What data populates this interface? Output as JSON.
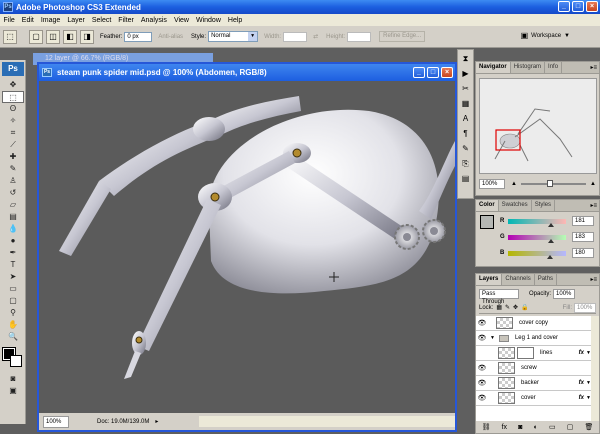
{
  "window": {
    "title": "Adobe Photoshop CS3 Extended",
    "app_icon": "Ps"
  },
  "menu": [
    "File",
    "Edit",
    "Image",
    "Layer",
    "Select",
    "Filter",
    "Analysis",
    "View",
    "Window",
    "Help"
  ],
  "options": {
    "feather_label": "Feather:",
    "feather_value": "0 px",
    "antialias_label": "Anti-alias",
    "style_label": "Style:",
    "style_value": "Normal",
    "width_label": "Width:",
    "height_label": "Height:",
    "refine_label": "Refine Edge...",
    "workspace_label": "Workspace"
  },
  "toolbox": {
    "logo": "Ps"
  },
  "document": {
    "back_title": "12 layer @ 66.7% (RGB/8)",
    "title": "steam punk spider mid.psd @ 100% (Abdomen, RGB/8)",
    "zoom": "100%",
    "doc_info": "Doc: 19.0M/139.0M"
  },
  "navigator": {
    "tabs": [
      "Navigator",
      "Histogram",
      "Info"
    ],
    "zoom": "100%"
  },
  "color": {
    "tabs": [
      "Color",
      "Swatches",
      "Styles"
    ],
    "r_label": "R",
    "r_value": "181",
    "g_label": "G",
    "g_value": "183",
    "b_label": "B",
    "b_value": "180",
    "swatch_color": "#b5b7b4"
  },
  "layers": {
    "tabs": [
      "Layers",
      "Channels",
      "Paths"
    ],
    "blend_mode": "Pass Through",
    "opacity_label": "Opacity:",
    "opacity_value": "100%",
    "lock_label": "Lock:",
    "fill_label": "Fill:",
    "fill_value": "100%",
    "items": [
      {
        "name": "cover copy"
      },
      {
        "name": "Leg 1 and cover"
      },
      {
        "name": "lines",
        "fx": "fx"
      },
      {
        "name": "screw"
      },
      {
        "name": "backer",
        "fx": "fx"
      },
      {
        "name": "cover",
        "fx": "fx"
      }
    ]
  }
}
